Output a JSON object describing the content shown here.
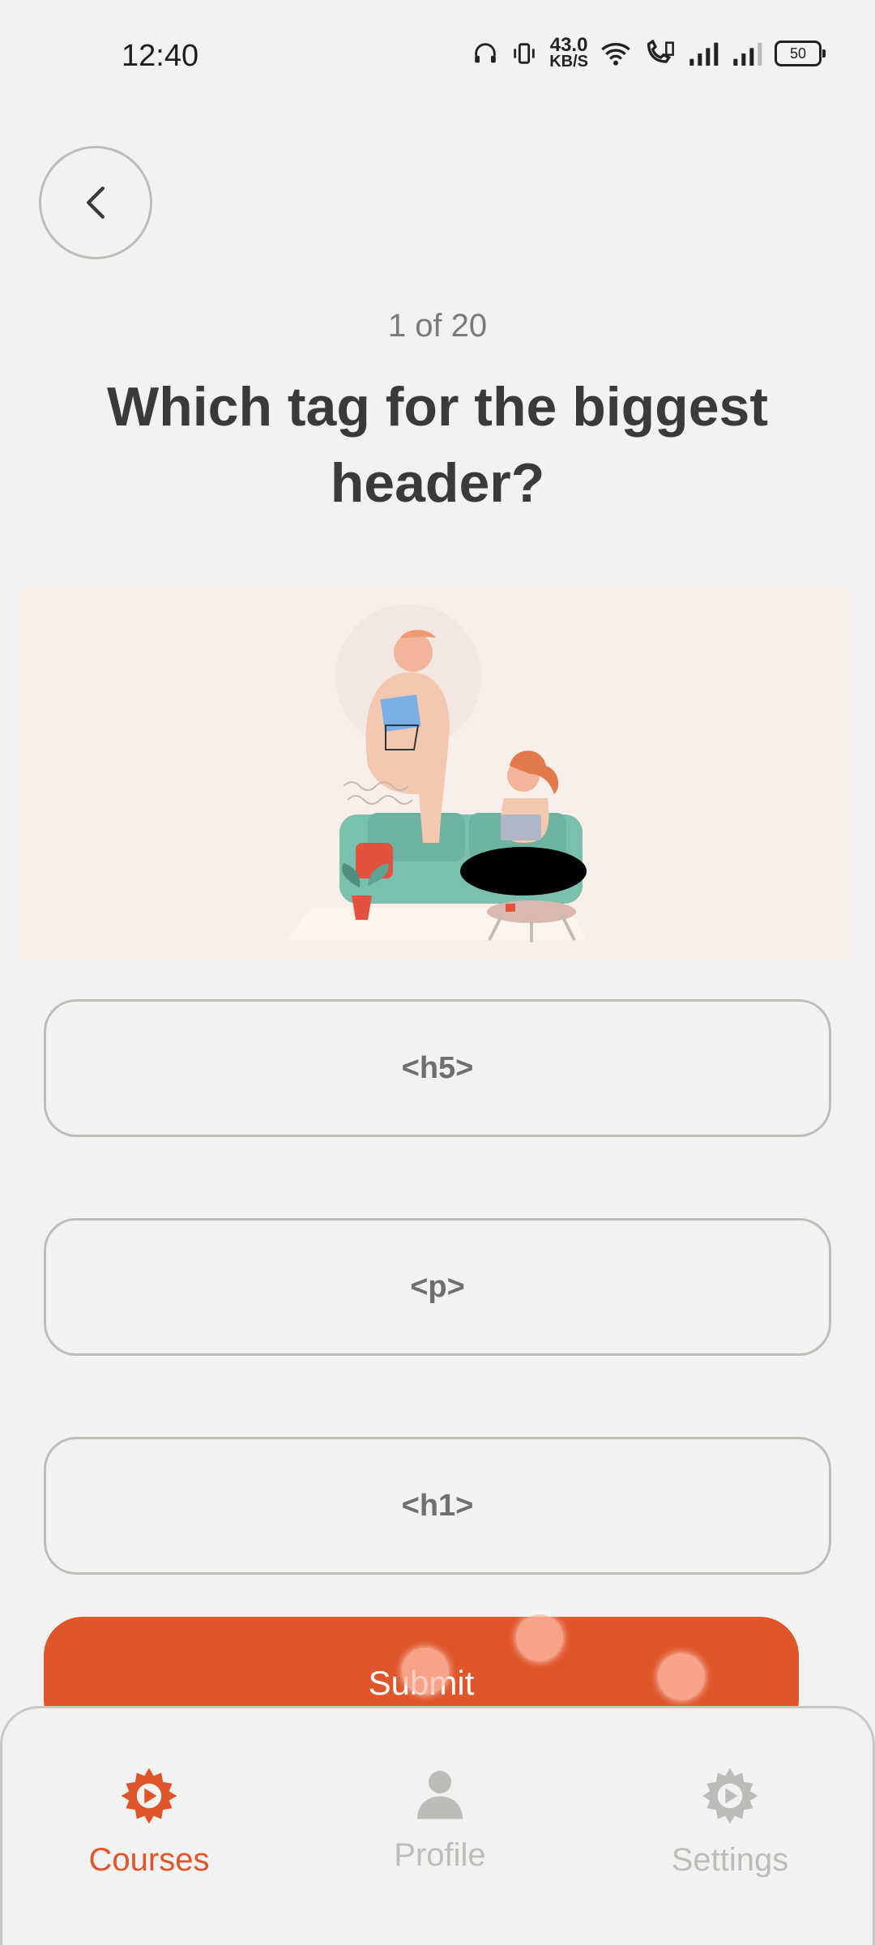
{
  "status_bar": {
    "time": "12:40",
    "net_speed_value": "43.0",
    "net_speed_unit": "KB/S",
    "battery": "50"
  },
  "quiz": {
    "progress": "1 of 20",
    "question": "Which tag for the biggest header?",
    "options": [
      "<h5>",
      "<p>",
      "<h1>"
    ],
    "submit_label": "Submit"
  },
  "nav": {
    "items": [
      {
        "label": "Courses",
        "icon": "gear-play-icon",
        "active": true
      },
      {
        "label": "Profile",
        "icon": "person-icon",
        "active": false
      },
      {
        "label": "Settings",
        "icon": "gear-play-icon",
        "active": false
      }
    ]
  },
  "colors": {
    "accent": "#e0552a",
    "inactive": "#bdbdb8",
    "background": "#f2f2f2"
  }
}
